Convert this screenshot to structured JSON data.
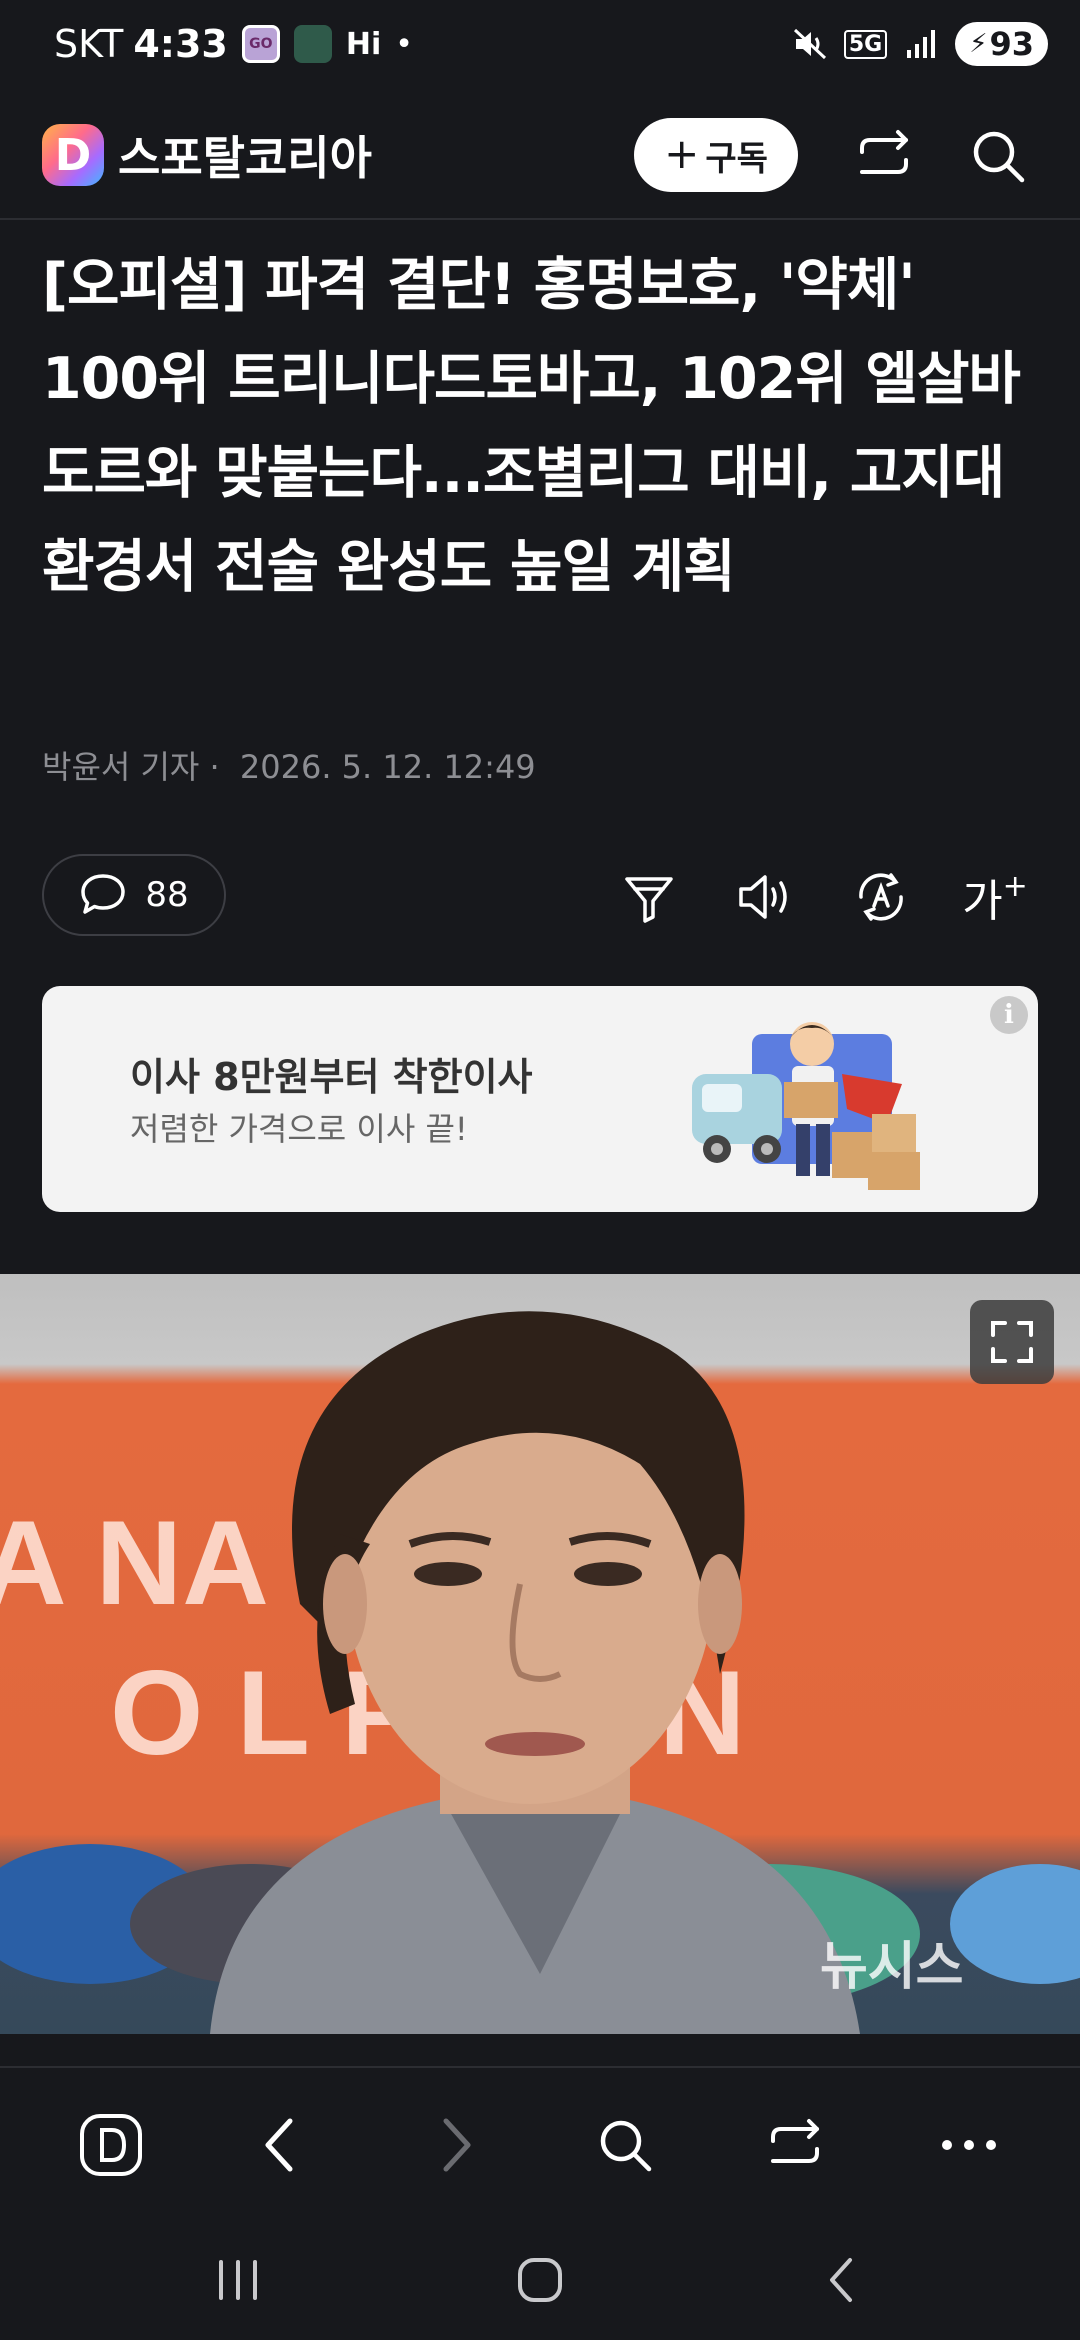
{
  "status_bar": {
    "carrier": "SKT",
    "time": "4:33",
    "app_badge_go": "GO",
    "hi_label": "Hi",
    "network": "5G",
    "battery": "93"
  },
  "header": {
    "logo_letter": "D",
    "site_name": "스포탈코리아",
    "subscribe_label": "구독",
    "subscribe_plus": "+"
  },
  "article": {
    "headline": "[오피셜] 파격 결단! 홍명보호, '약체' 100위 트리니다드토바고, 102위 엘살바도르와 맞붙는다...조별리그 대비, 고지대 환경서 전술 완성도 높일 계획",
    "reporter": "박윤서 기자 ·",
    "date": "2026. 5. 12. 12:49",
    "comment_count": "88",
    "font_size_label": "가"
  },
  "ad": {
    "title": "이사 8만원부터 착한이사",
    "subtitle": "저렴한 가격으로 이사 끝!",
    "info_mark": "i"
  },
  "photo": {
    "background_text_1": "A NA    L FOOT",
    "background_text_2": "O    L PARTN",
    "watermark": "뉴시스"
  },
  "colors": {
    "background": "#17181c",
    "text": "#ffffff",
    "muted": "#8d8e93",
    "ad_background": "#f3f3f3"
  },
  "icons": [
    "share-icon",
    "search-icon",
    "comment-icon",
    "filter-icon",
    "speaker-icon",
    "translate-icon",
    "expand-icon",
    "home-d-icon",
    "back-icon",
    "forward-icon",
    "more-icon"
  ]
}
